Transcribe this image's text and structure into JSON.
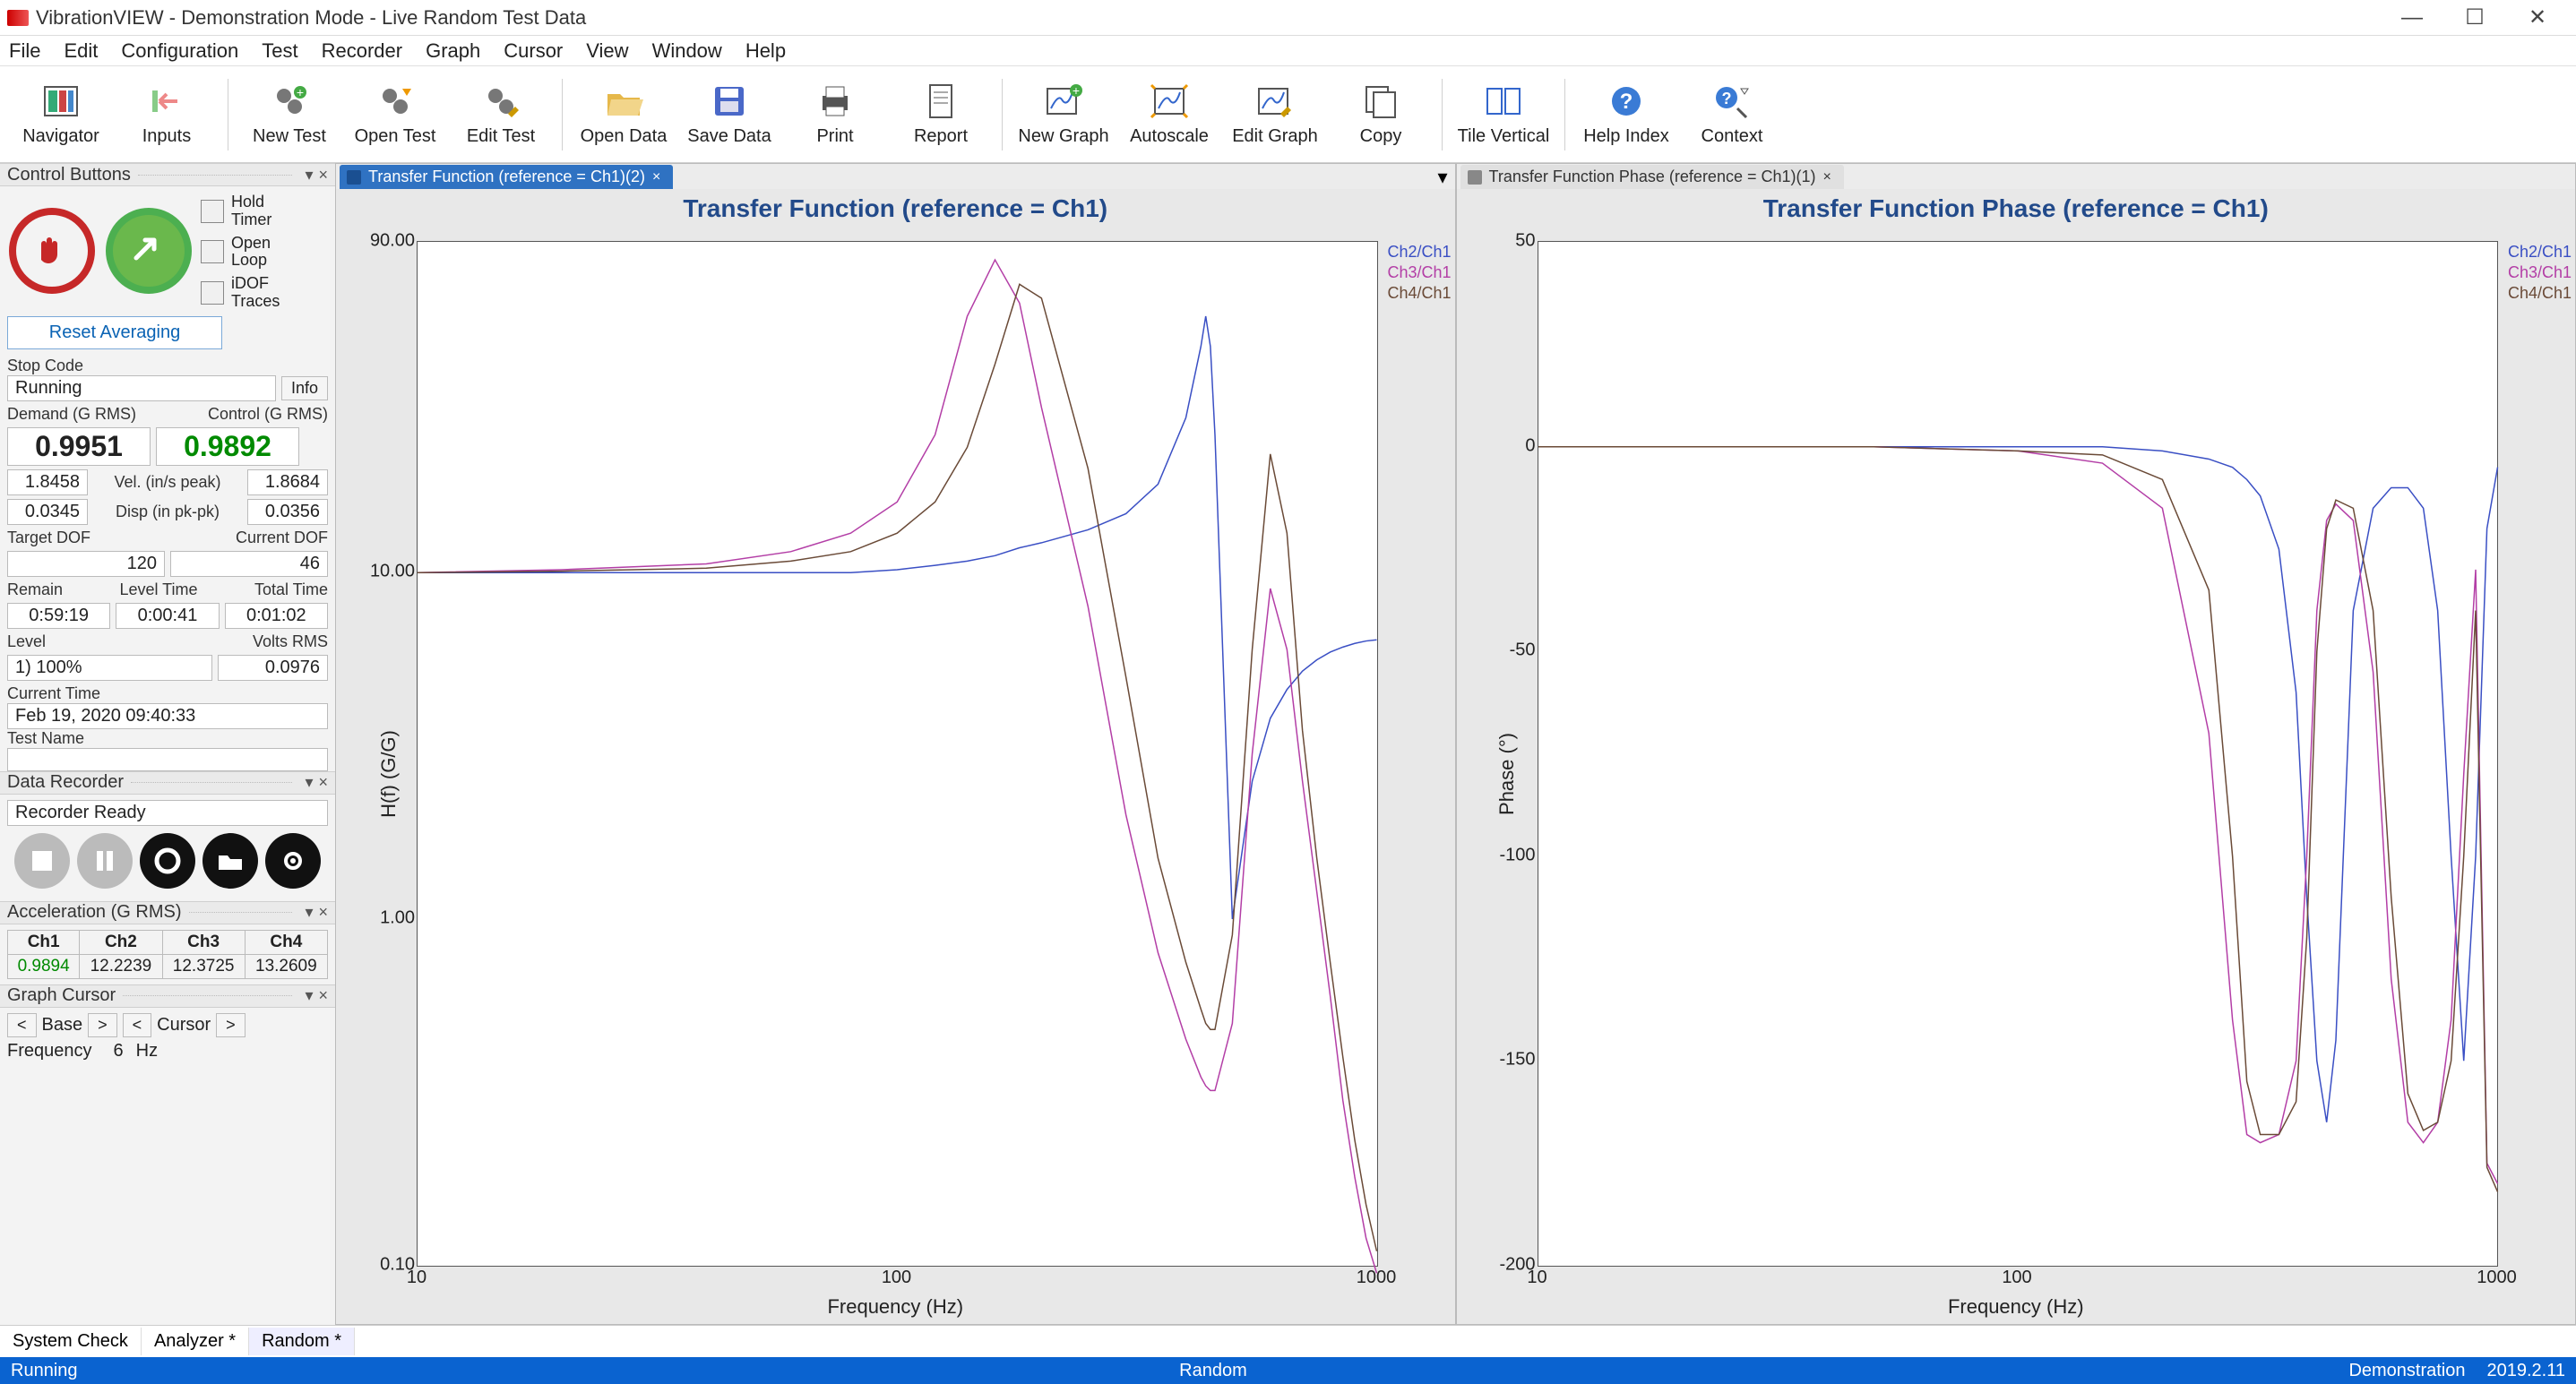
{
  "window": {
    "title": "VibrationVIEW - Demonstration Mode - Live Random Test Data"
  },
  "menu": [
    "File",
    "Edit",
    "Configuration",
    "Test",
    "Recorder",
    "Graph",
    "Cursor",
    "View",
    "Window",
    "Help"
  ],
  "toolbar": {
    "groups": [
      [
        "Navigator",
        "Inputs"
      ],
      [
        "New Test",
        "Open Test",
        "Edit Test"
      ],
      [
        "Open Data",
        "Save Data",
        "Print",
        "Report"
      ],
      [
        "New Graph",
        "Autoscale",
        "Edit Graph",
        "Copy"
      ],
      [
        "Tile Vertical"
      ],
      [
        "Help Index",
        "Context"
      ]
    ]
  },
  "panels": {
    "control_buttons": {
      "title": "Control Buttons",
      "checks": [
        {
          "label": "Hold\nTimer"
        },
        {
          "label": "Open\nLoop"
        },
        {
          "label": "iDOF\nTraces"
        }
      ],
      "reset": "Reset Averaging",
      "stop_code_label": "Stop Code",
      "stop_code": "Running",
      "info": "Info",
      "demand_label": "Demand (G RMS)",
      "control_label": "Control (G RMS)",
      "demand": "0.9951",
      "control": "0.9892",
      "vel_label": "Vel. (in/s peak)",
      "vel_l": "1.8458",
      "vel_r": "1.8684",
      "disp_label": "Disp (in pk-pk)",
      "disp_l": "0.0345",
      "disp_r": "0.0356",
      "target_dof_label": "Target DOF",
      "target_dof": "120",
      "current_dof_label": "Current DOF",
      "current_dof": "46",
      "remain_label": "Remain",
      "remain": "0:59:19",
      "level_time_label": "Level Time",
      "level_time": "0:00:41",
      "total_time_label": "Total Time",
      "total_time": "0:01:02",
      "level_label": "Level",
      "level": "1) 100%",
      "volts_label": "Volts RMS",
      "volts": "0.0976",
      "current_time_label": "Current Time",
      "current_time": "Feb 19, 2020 09:40:33",
      "test_name_label": "Test Name",
      "test_name": ""
    },
    "data_recorder": {
      "title": "Data Recorder",
      "status": "Recorder Ready"
    },
    "acceleration": {
      "title": "Acceleration (G RMS)",
      "headers": [
        "Ch1",
        "Ch2",
        "Ch3",
        "Ch4"
      ],
      "values": [
        "0.9894",
        "12.2239",
        "12.3725",
        "13.2609"
      ]
    },
    "cursor": {
      "title": "Graph Cursor",
      "base": "Base",
      "cursor": "Cursor",
      "freq_label": "Frequency",
      "freq_val": "6",
      "freq_unit": "Hz"
    }
  },
  "tabs": {
    "left": "Transfer Function (reference = Ch1)(2)",
    "right": "Transfer Function Phase (reference = Ch1)(1)"
  },
  "footer_tabs": [
    "System Check",
    "Analyzer *",
    "Random *"
  ],
  "status": {
    "running": "Running",
    "mode": "Random",
    "demo": "Demonstration",
    "ver": "2019.2.11"
  },
  "chart_data": [
    {
      "type": "line",
      "title": "Transfer Function (reference = Ch1)",
      "xlabel": "Frequency (Hz)",
      "ylabel": "H(f) (G/G)",
      "xscale": "log",
      "yscale": "log",
      "xlim": [
        10,
        1000
      ],
      "ylim": [
        0.1,
        90
      ],
      "xticks": [
        10,
        100,
        1000
      ],
      "yticks": [
        0.1,
        1.0,
        10.0,
        90.0
      ],
      "legend": [
        "Ch2/Ch1",
        "Ch3/Ch1",
        "Ch4/Ch1"
      ],
      "legend_colors": [
        "#3a4fc4",
        "#b33ea6",
        "#6a4a37"
      ],
      "x": [
        10,
        20,
        40,
        60,
        80,
        100,
        120,
        140,
        160,
        180,
        200,
        250,
        300,
        350,
        400,
        430,
        440,
        450,
        460,
        500,
        550,
        600,
        650,
        700,
        750,
        800,
        850,
        900,
        950,
        1000
      ],
      "series": [
        {
          "name": "Ch2/Ch1",
          "color": "#3a4fc4",
          "values": [
            10,
            10,
            10,
            10,
            10,
            10.2,
            10.5,
            10.8,
            11.2,
            11.8,
            12.2,
            13.3,
            14.8,
            18,
            28,
            45,
            55,
            45,
            25,
            1.0,
            2.5,
            3.8,
            4.6,
            5.2,
            5.6,
            5.9,
            6.1,
            6.25,
            6.35,
            6.4
          ]
        },
        {
          "name": "Ch3/Ch1",
          "color": "#b33ea6",
          "values": [
            10,
            10.2,
            10.6,
            11.5,
            13,
            16,
            25,
            55,
            80,
            60,
            30,
            8,
            2,
            0.8,
            0.45,
            0.35,
            0.33,
            0.32,
            0.32,
            0.5,
            3,
            9,
            6,
            2.5,
            1.2,
            0.6,
            0.3,
            0.18,
            0.12,
            0.095
          ]
        },
        {
          "name": "Ch4/Ch1",
          "color": "#6a4a37",
          "values": [
            10,
            10.1,
            10.3,
            10.8,
            11.5,
            13,
            16,
            23,
            40,
            68,
            62,
            20,
            5,
            1.5,
            0.75,
            0.55,
            0.5,
            0.48,
            0.48,
            0.9,
            6,
            22,
            13,
            3.5,
            1.5,
            0.75,
            0.4,
            0.23,
            0.15,
            0.11
          ]
        }
      ]
    },
    {
      "type": "line",
      "title": "Transfer Function Phase (reference = Ch1)",
      "xlabel": "Frequency (Hz)",
      "ylabel": "Phase (°)",
      "xscale": "log",
      "yscale": "linear",
      "xlim": [
        10,
        1000
      ],
      "ylim": [
        -200,
        50
      ],
      "xticks": [
        10,
        100,
        1000
      ],
      "yticks": [
        -200,
        -150,
        -100,
        -50,
        0,
        50
      ],
      "legend": [
        "Ch2/Ch1",
        "Ch3/Ch1",
        "Ch4/Ch1"
      ],
      "legend_colors": [
        "#3a4fc4",
        "#b33ea6",
        "#6a4a37"
      ],
      "x": [
        10,
        50,
        100,
        150,
        200,
        250,
        280,
        300,
        320,
        350,
        380,
        400,
        420,
        440,
        460,
        500,
        550,
        600,
        650,
        700,
        750,
        800,
        850,
        900,
        950,
        1000
      ],
      "series": [
        {
          "name": "Ch2/Ch1",
          "color": "#3a4fc4",
          "values": [
            0,
            0,
            0,
            0,
            -1,
            -3,
            -5,
            -8,
            -12,
            -25,
            -60,
            -110,
            -150,
            -165,
            -145,
            -40,
            -15,
            -10,
            -10,
            -15,
            -40,
            -100,
            -150,
            -100,
            -20,
            -5
          ]
        },
        {
          "name": "Ch3/Ch1",
          "color": "#b33ea6",
          "values": [
            0,
            0,
            -1,
            -4,
            -15,
            -70,
            -140,
            -168,
            -170,
            -168,
            -150,
            -100,
            -40,
            -18,
            -14,
            -18,
            -55,
            -130,
            -165,
            -170,
            -165,
            -140,
            -80,
            -30,
            -175,
            -180
          ]
        },
        {
          "name": "Ch4/Ch1",
          "color": "#6a4a37",
          "values": [
            0,
            0,
            -1,
            -2,
            -8,
            -35,
            -100,
            -155,
            -168,
            -168,
            -160,
            -120,
            -50,
            -20,
            -13,
            -15,
            -40,
            -110,
            -158,
            -167,
            -165,
            -150,
            -100,
            -40,
            -176,
            -182
          ]
        }
      ]
    }
  ]
}
